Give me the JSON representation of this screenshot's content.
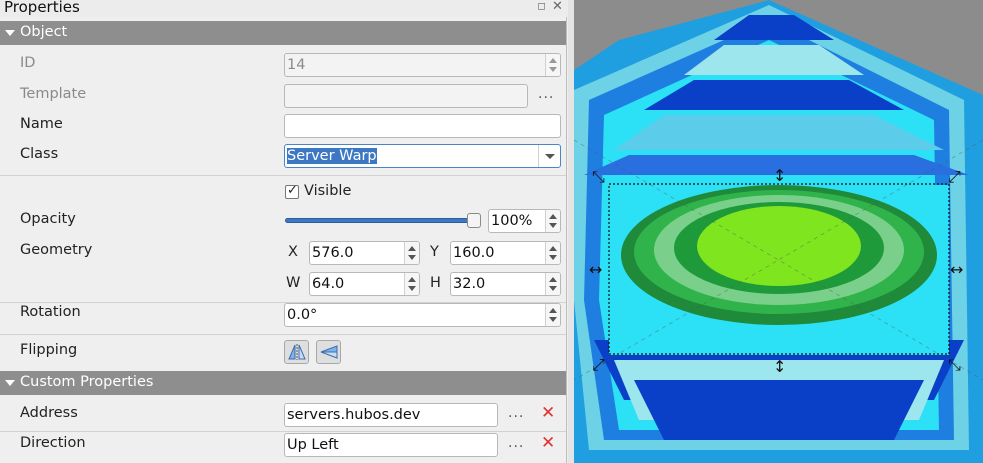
{
  "panel": {
    "title": "Properties",
    "float_icon": "float-icon",
    "close_icon": "close-icon"
  },
  "object_section": {
    "title": "Object",
    "id_label": "ID",
    "id_value": "14",
    "template_label": "Template",
    "template_value": "",
    "template_browse": "...",
    "name_label": "Name",
    "name_value": "",
    "class_label": "Class",
    "class_value": "Server Warp",
    "visible_label": "Visible",
    "visible_checked": true,
    "opacity_label": "Opacity",
    "opacity_value": "100%",
    "opacity_fraction": 1.0,
    "geometry_label": "Geometry",
    "x_label": "X",
    "x_value": "576.0",
    "y_label": "Y",
    "y_value": "160.0",
    "w_label": "W",
    "w_value": "64.0",
    "h_label": "H",
    "h_value": "32.0",
    "rotation_label": "Rotation",
    "rotation_value": "0.0°",
    "flipping_label": "Flipping",
    "flip_horizontal_icon": "flip-horizontal-icon",
    "flip_vertical_icon": "flip-vertical-icon"
  },
  "custom_section": {
    "title": "Custom Properties",
    "properties": [
      {
        "name": "Address",
        "value": "servers.hubos.dev",
        "browse": "...",
        "remove_icon": "remove-icon"
      },
      {
        "name": "Direction",
        "value": "Up Left",
        "browse": "...",
        "remove_icon": "remove-icon"
      }
    ]
  },
  "colors": {
    "section_header": "#8e8e8e",
    "selection": "#3c78c3",
    "remove": "#dd3333",
    "tile_light_cyan": "#2ce0f5",
    "tile_dark_blue": "#0a3fc8",
    "tile_green": "#2fb34a",
    "tile_lime": "#7ee51f",
    "map_background": "#8c8c8c"
  }
}
